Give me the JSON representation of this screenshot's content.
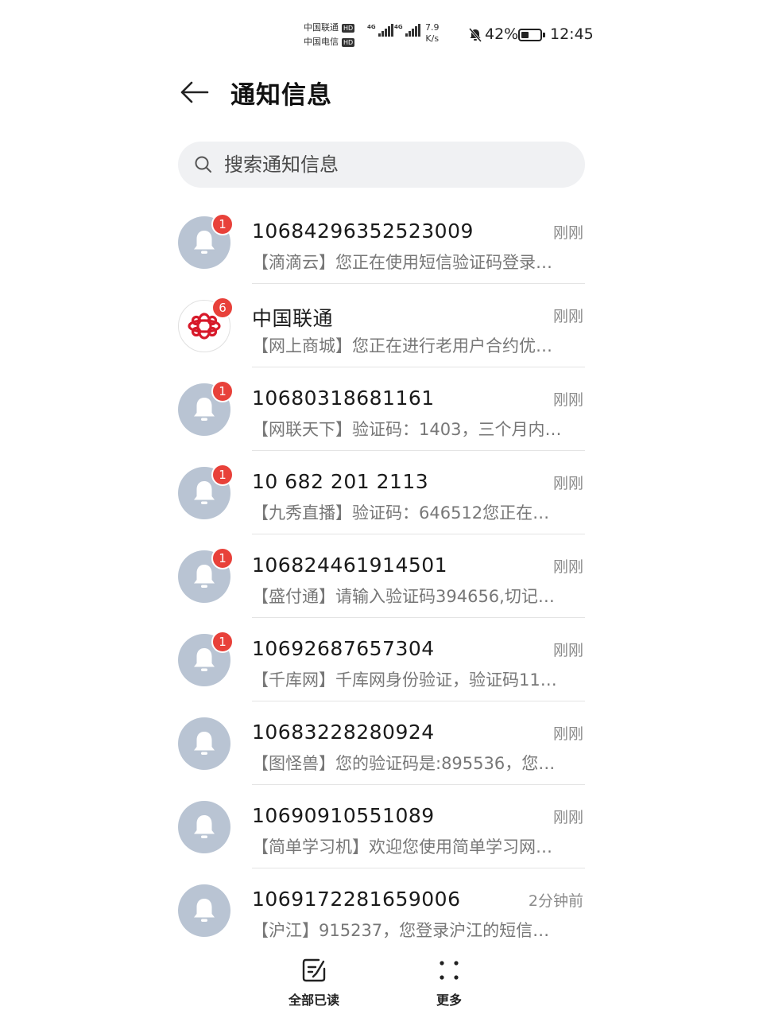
{
  "status_bar": {
    "carrier1": "中国联通",
    "carrier2": "中国电信",
    "hd": "HD",
    "network1": "4G",
    "network2": "4G",
    "speed_value": "7.9",
    "speed_unit": "K/s",
    "battery_percent": "42%",
    "battery_level": 0.42,
    "time": "12:45"
  },
  "header": {
    "title": "通知信息"
  },
  "search": {
    "placeholder": "搜索通知信息"
  },
  "messages": [
    {
      "sender": "10684296352523009",
      "time": "刚刚",
      "preview": "【滴滴云】您正在使用短信验证码登录…",
      "badge": "1",
      "avatar": "bell"
    },
    {
      "sender": "中国联通",
      "time": "刚刚",
      "preview": "【网上商城】您正在进行老用户合约优…",
      "badge": "6",
      "avatar": "unicom-logo"
    },
    {
      "sender": "10680318681161",
      "time": "刚刚",
      "preview": "【网联天下】验证码：1403，三个月内…",
      "badge": "1",
      "avatar": "bell"
    },
    {
      "sender": "10 682 201 2113",
      "time": "刚刚",
      "preview": "【九秀直播】验证码：646512您正在…",
      "badge": "1",
      "avatar": "bell"
    },
    {
      "sender": "106824461914501",
      "time": "刚刚",
      "preview": "【盛付通】请输入验证码394656,切记…",
      "badge": "1",
      "avatar": "bell"
    },
    {
      "sender": "10692687657304",
      "time": "刚刚",
      "preview": "【千库网】千库网身份验证，验证码11…",
      "badge": "1",
      "avatar": "bell"
    },
    {
      "sender": "10683228280924",
      "time": "刚刚",
      "preview": "【图怪兽】您的验证码是:895536，您…",
      "badge": "",
      "avatar": "bell"
    },
    {
      "sender": "10690910551089",
      "time": "刚刚",
      "preview": "【简单学习机】欢迎您使用简单学习网…",
      "badge": "",
      "avatar": "bell"
    },
    {
      "sender": "1069172281659006",
      "time": "2分钟前",
      "preview": "【沪江】915237，您登录沪江的短信…",
      "badge": "",
      "avatar": "bell"
    }
  ],
  "bottom_bar": {
    "mark_all_read": "全部已读",
    "more": "更多"
  },
  "colors": {
    "badge": "#e8413a",
    "avatar_bg": "#b9c4d3",
    "unicom_red": "#d7192a",
    "search_bg": "#f0f1f3"
  }
}
